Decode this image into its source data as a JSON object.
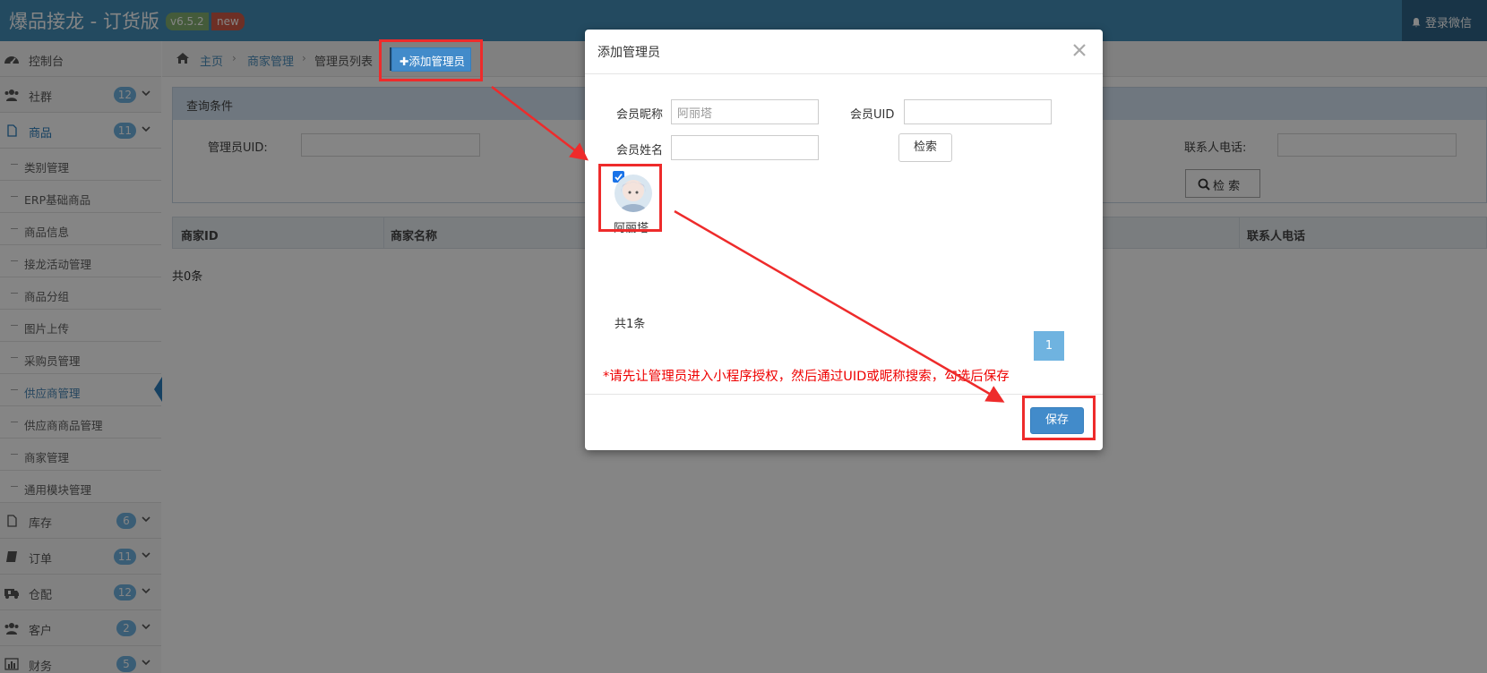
{
  "app": {
    "title": "爆品接龙 - 订货版",
    "version": "v6.5.2",
    "new_badge": "new",
    "login_label": "登录微信"
  },
  "sidebar": {
    "items": [
      {
        "label": "控制台",
        "icon": "dashboard-icon"
      },
      {
        "label": "社群",
        "badge": "12",
        "icon": "users-icon"
      },
      {
        "label": "商品",
        "badge": "11",
        "icon": "file-icon"
      },
      {
        "label": "库存",
        "badge": "6",
        "icon": "file-icon"
      },
      {
        "label": "订单",
        "badge": "11",
        "icon": "book-icon"
      },
      {
        "label": "仓配",
        "badge": "12",
        "icon": "ambulance-icon"
      },
      {
        "label": "客户",
        "badge": "2",
        "icon": "users-icon"
      },
      {
        "label": "财务",
        "badge": "5",
        "icon": "bar-chart-icon"
      }
    ],
    "sub_items": [
      "类别管理",
      "ERP基础商品",
      "商品信息",
      "接龙活动管理",
      "商品分组",
      "图片上传",
      "采购员管理",
      "供应商管理",
      "供应商商品管理",
      "商家管理",
      "通用模块管理"
    ]
  },
  "breadcrumb": {
    "home": "主页",
    "level1": "商家管理",
    "current": "管理员列表",
    "add_button": "添加管理员"
  },
  "query": {
    "title": "查询条件",
    "admin_uid_label": "管理员UID:",
    "contact_phone_label": "联系人电话:",
    "search_button": "检 索"
  },
  "table": {
    "columns": [
      "商家ID",
      "商家名称",
      "联系人电话"
    ],
    "total": "共0条"
  },
  "modal": {
    "title": "添加管理员",
    "nickname_label": "会员昵称",
    "nickname_value": "阿丽塔",
    "uid_label": "会员UID",
    "uid_value": "",
    "name_label": "会员姓名",
    "name_value": "",
    "search_button": "检索",
    "member_name": "阿丽塔",
    "total": "共1条",
    "page": "1",
    "note": "*请先让管理员进入小程序授权，然后通过UID或昵称搜索，勾选后保存",
    "save_button": "保存"
  },
  "colors": {
    "header": "#438eb9",
    "accent": "#428bca",
    "highlight": "#ee2b2b"
  }
}
